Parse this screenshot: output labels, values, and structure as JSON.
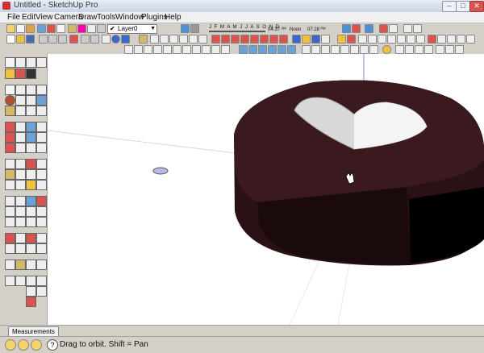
{
  "window": {
    "title": "Untitled - SketchUp Pro"
  },
  "window_controls": {
    "minimize": "–",
    "maximize": "□",
    "close": "✕"
  },
  "menu": [
    "File",
    "Edit",
    "View",
    "Camera",
    "Draw",
    "Tools",
    "Window",
    "Plugins",
    "Help"
  ],
  "layers": {
    "check": "✔",
    "current": "Layer0",
    "arrow": "▼"
  },
  "shadows": {
    "months": "J F M A M J J A S O N D",
    "time_start": "04:37 ᴬᴹ",
    "noon": "Noon",
    "time_end": "07:28 ᴾᴹ"
  },
  "measurements": {
    "label": "Measurements"
  },
  "status": {
    "text": "Drag to orbit.  Shift = Pan"
  },
  "icons": [
    "app-icon",
    "select-icon",
    "paint-icon",
    "eraser-icon",
    "line-icon",
    "arc-icon",
    "rectangle-icon",
    "push-pull-icon",
    "move-icon",
    "rotate-icon",
    "tape-icon",
    "orbit-icon",
    "pan-icon",
    "zoom-icon",
    "help-icon"
  ],
  "colors": {
    "puck_top": "#3a1a1f",
    "puck_side": "#2a1115",
    "heart": "#d8d8d8",
    "title_bar": "#c9d4e6"
  }
}
